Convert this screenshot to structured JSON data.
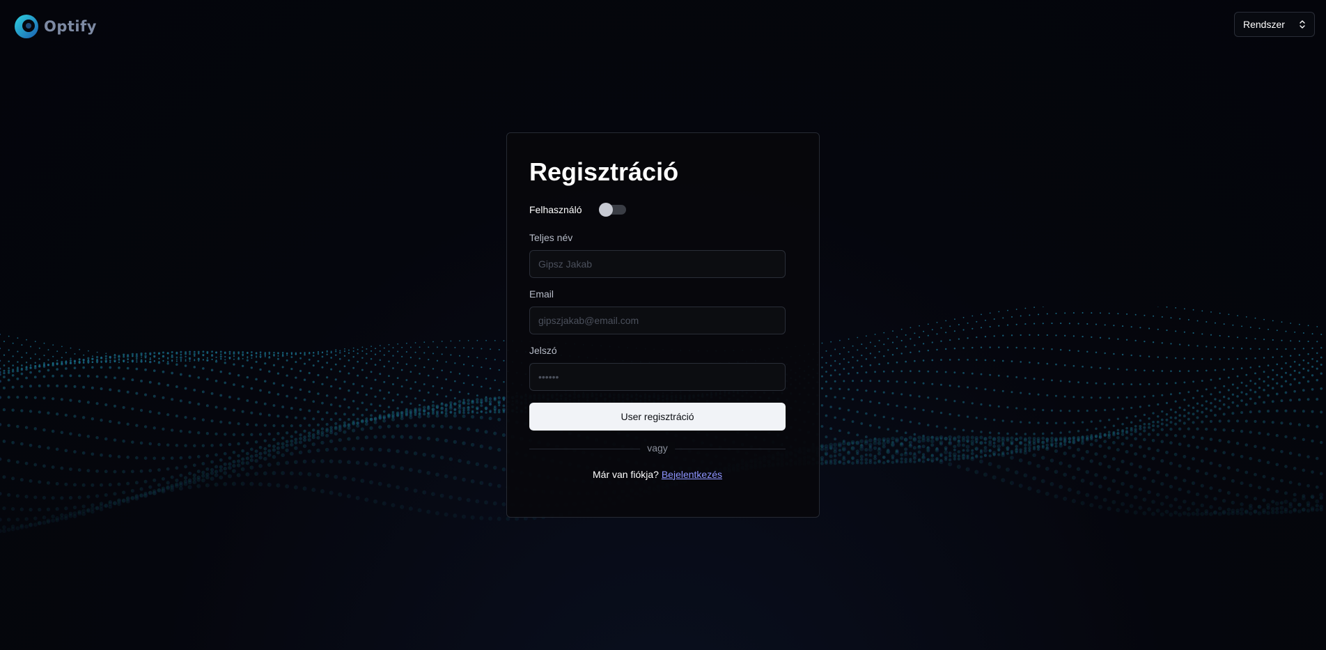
{
  "brand": {
    "name": "Optify",
    "accent": "#1fb2c9"
  },
  "header": {
    "system_select": {
      "value": "Rendszer"
    }
  },
  "register": {
    "title": "Regisztráció",
    "toggle_label": "Felhasználó",
    "toggle_on": false,
    "fields": {
      "fullname": {
        "label": "Teljes név",
        "placeholder": "Gipsz Jakab",
        "value": ""
      },
      "email": {
        "label": "Email",
        "placeholder": "gipszjakab@email.com",
        "value": ""
      },
      "password": {
        "label": "Jelszó",
        "placeholder": "••••••",
        "value": ""
      }
    },
    "submit_label": "User regisztráció",
    "divider_text": "vagy",
    "signin_prompt": "Már van fiókja?",
    "signin_link": "Bejelentkezés"
  },
  "colors": {
    "background": "#05060d",
    "card_border": "#262a33",
    "button_bg": "#f1f3f7",
    "link": "#8e94ff",
    "wave_left": "#1ab0a8",
    "wave_right": "#4050d0"
  }
}
